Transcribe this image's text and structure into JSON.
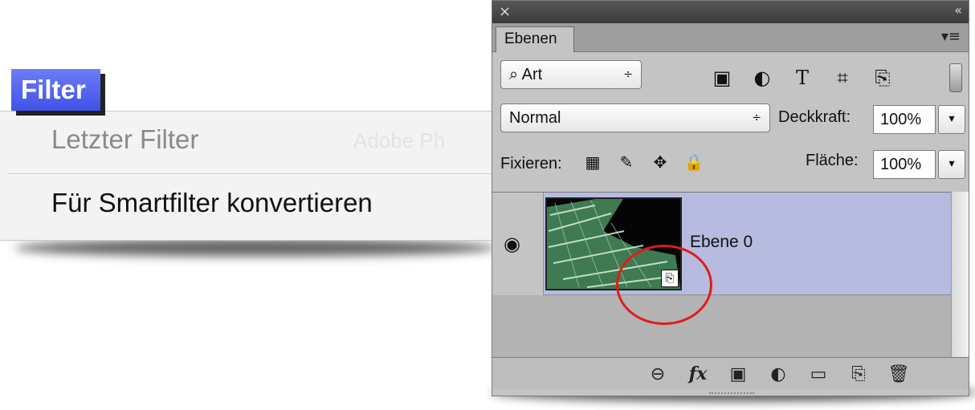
{
  "filter_menu": {
    "title": "Filter",
    "items": [
      {
        "label": "Letzter Filter",
        "enabled": false,
        "faded_shortcut": "Adobe Ph"
      },
      {
        "label": "Für Smartfilter konvertieren",
        "enabled": true
      }
    ],
    "accent": "#4a5cf0"
  },
  "layers_panel": {
    "titlebar": {
      "close_icon": "close-icon",
      "collapse_icon": "double-chevron-icon",
      "close_glyph": "×",
      "collapse_glyph": "«"
    },
    "tab_label": "Ebenen",
    "panel_menu_glyph": "▾≡",
    "filter_type": {
      "value": "Art",
      "arrows": "÷"
    },
    "filter_icon_glyphs": [
      "▣",
      "◐",
      "T",
      "⌗",
      "⎘"
    ],
    "blend_mode": {
      "value": "Normal",
      "arrows": "÷"
    },
    "opacity": {
      "label": "Deckkraft:",
      "value": "100%",
      "arrow": "▾"
    },
    "lock": {
      "label": "Fixieren:",
      "glyphs": [
        "▦",
        "✎",
        "✥",
        "🔒"
      ]
    },
    "fill": {
      "label": "Fläche:",
      "value": "100%",
      "arrow": "▾"
    },
    "layers": [
      {
        "name": "Ebene 0",
        "visible": true,
        "smart_object": true,
        "selected": true,
        "eye_glyph": "◉",
        "badge_glyph": "⎘"
      }
    ],
    "bottom_icons": [
      "link-icon",
      "fx-icon",
      "mask-icon",
      "adjustment-icon",
      "folder-icon",
      "new-layer-icon",
      "trash-icon"
    ],
    "bottom_glyphs": [
      "⊖",
      "fx",
      "▣",
      "◐",
      "▭",
      "⎘",
      "🗑"
    ],
    "selected_row_color": "#b6bbdf",
    "highlight_color": "#e11b1b"
  }
}
